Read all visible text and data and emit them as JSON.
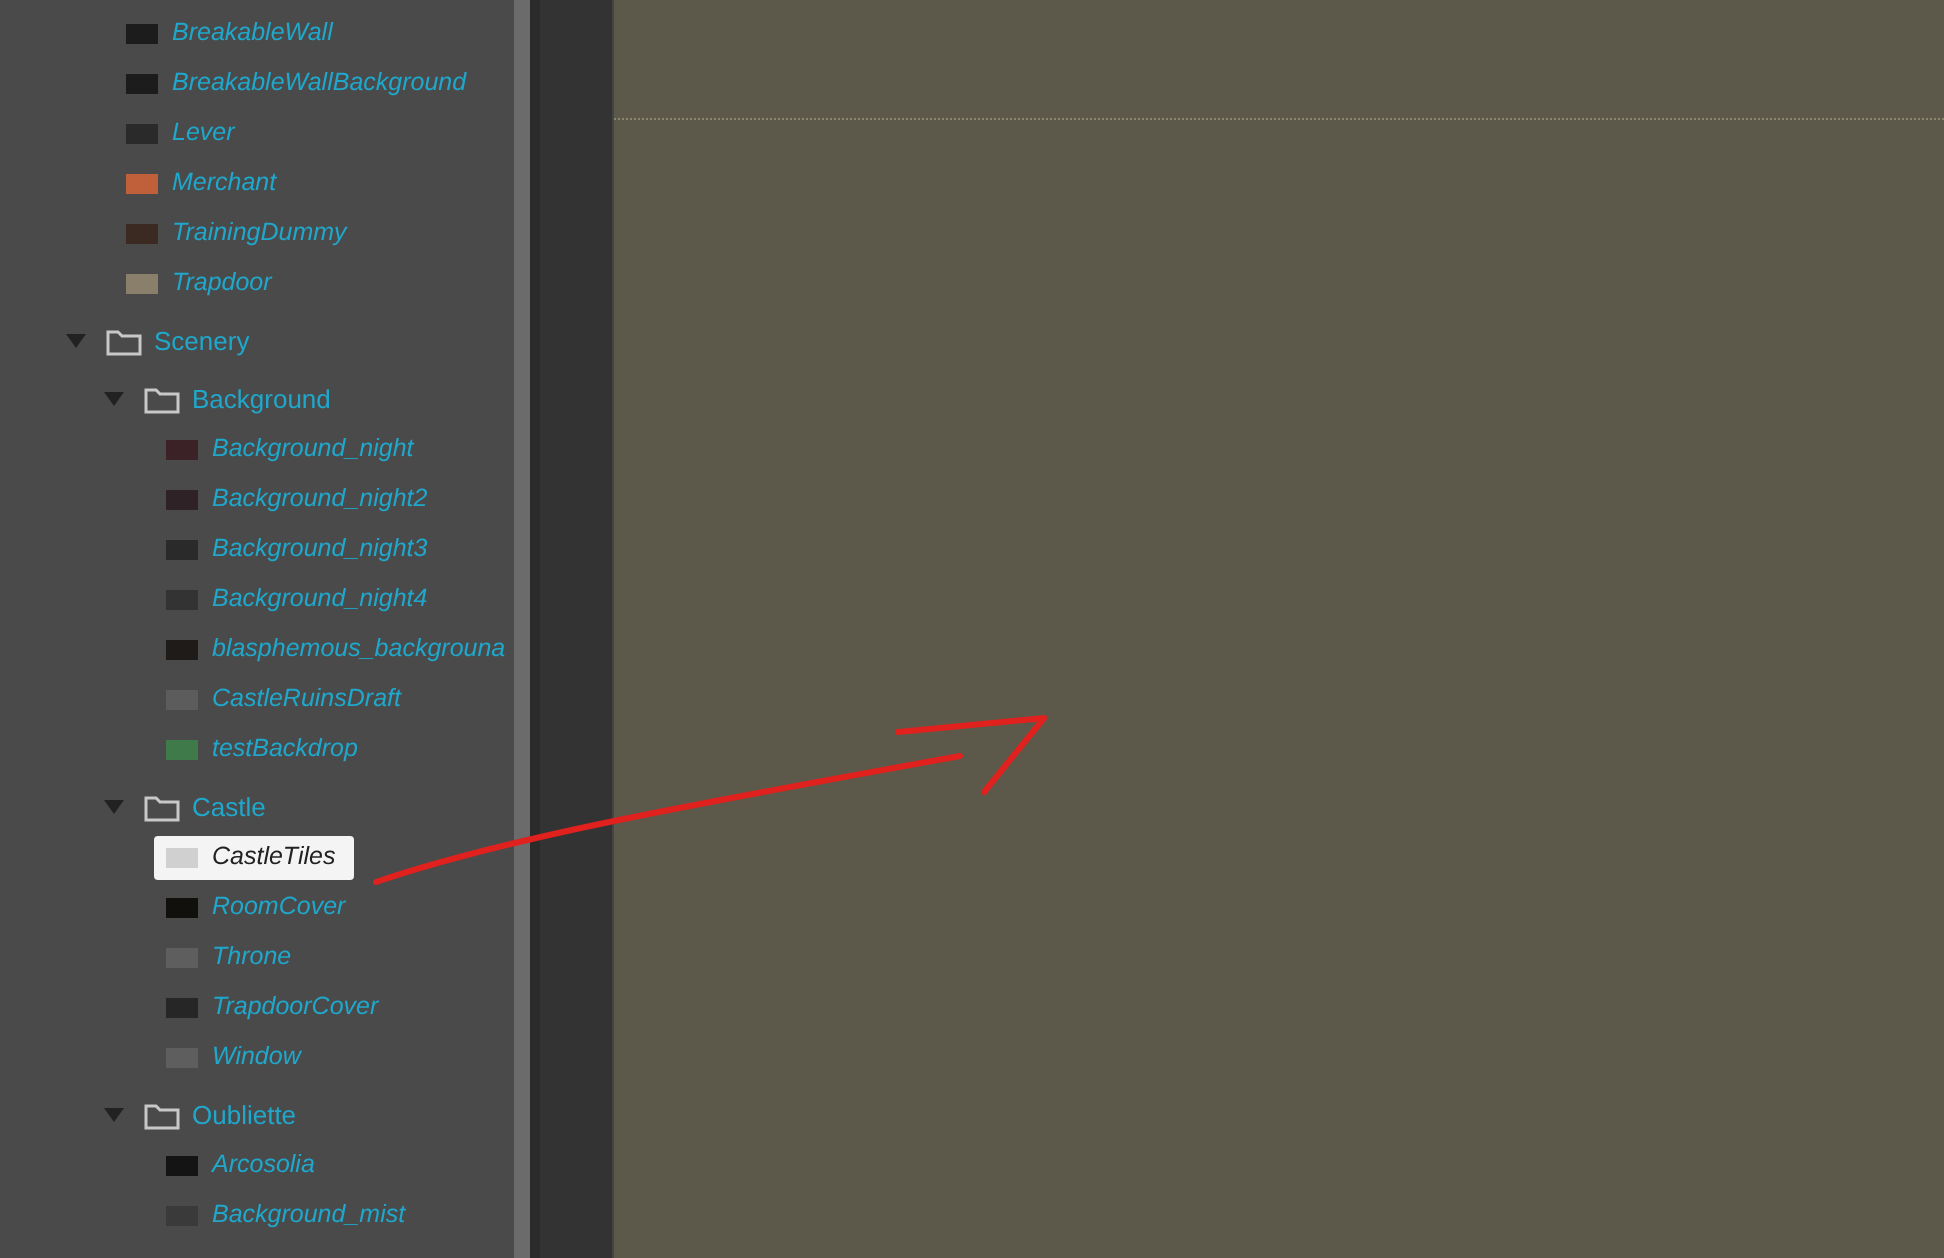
{
  "tree": [
    {
      "kind": "item",
      "label": "BreakableWall",
      "selected": false
    },
    {
      "kind": "item",
      "label": "BreakableWallBackground",
      "selected": false
    },
    {
      "kind": "item",
      "label": "Lever",
      "selected": false
    },
    {
      "kind": "item",
      "label": "Merchant",
      "selected": false
    },
    {
      "kind": "item",
      "label": "TrainingDummy",
      "selected": false
    },
    {
      "kind": "item",
      "label": "Trapdoor",
      "selected": false
    },
    {
      "kind": "folder",
      "label": "Scenery",
      "expanded": true,
      "children": [
        {
          "kind": "folder",
          "label": "Background",
          "expanded": true,
          "children": [
            {
              "kind": "item",
              "label": "Background_night",
              "selected": false
            },
            {
              "kind": "item",
              "label": "Background_night2",
              "selected": false
            },
            {
              "kind": "item",
              "label": "Background_night3",
              "selected": false
            },
            {
              "kind": "item",
              "label": "Background_night4",
              "selected": false
            },
            {
              "kind": "item",
              "label": "blasphemous_backgrouna",
              "selected": false
            },
            {
              "kind": "item",
              "label": "CastleRuinsDraft",
              "selected": false
            },
            {
              "kind": "item",
              "label": "testBackdrop",
              "selected": false
            }
          ]
        },
        {
          "kind": "folder",
          "label": "Castle",
          "expanded": true,
          "children": [
            {
              "kind": "item",
              "label": "CastleTiles",
              "selected": true
            },
            {
              "kind": "item",
              "label": "RoomCover",
              "selected": false
            },
            {
              "kind": "item",
              "label": "Throne",
              "selected": false
            },
            {
              "kind": "item",
              "label": "TrapdoorCover",
              "selected": false
            },
            {
              "kind": "item",
              "label": "Window",
              "selected": false
            }
          ]
        },
        {
          "kind": "folder",
          "label": "Oubliette",
          "expanded": true,
          "children": [
            {
              "kind": "item",
              "label": "Arcosolia",
              "selected": false
            },
            {
              "kind": "item",
              "label": "Background_mist",
              "selected": false
            }
          ]
        }
      ]
    }
  ]
}
